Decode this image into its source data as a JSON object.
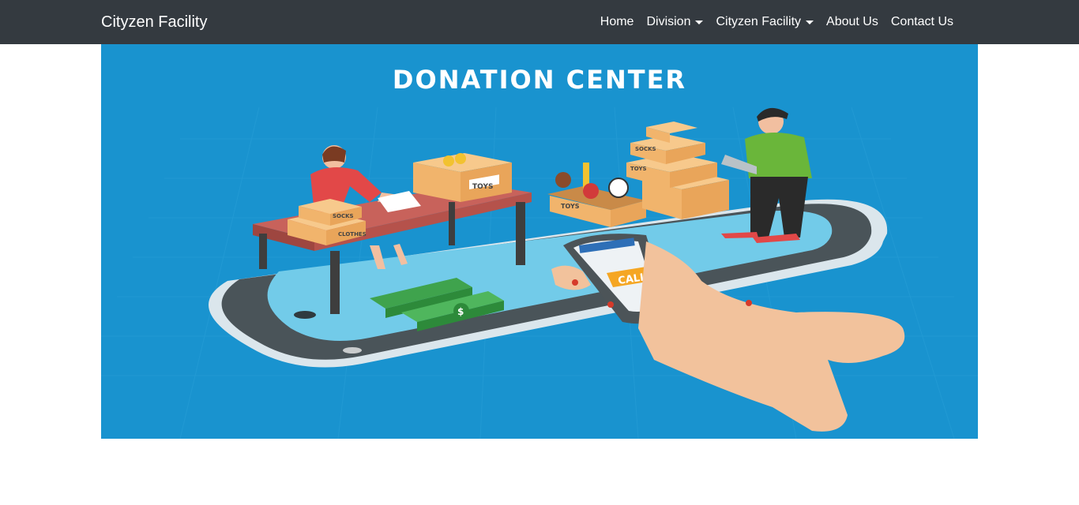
{
  "navbar": {
    "brand": "Cityzen Facility",
    "items": [
      {
        "label": "Home",
        "dropdown": false
      },
      {
        "label": "Division",
        "dropdown": true
      },
      {
        "label": "Cityzen Facility",
        "dropdown": true
      },
      {
        "label": "About Us",
        "dropdown": false
      },
      {
        "label": "Contact Us",
        "dropdown": false
      }
    ],
    "background": "#343a40"
  },
  "hero": {
    "title": "DONATION CENTER",
    "background": "#1993cf",
    "labels": {
      "toys_box_table": "TOYS",
      "socks": "SOCKS",
      "clothes": "CLOTHES",
      "toys_open_box": "TOYS",
      "socks_stack": "SOCKS",
      "toys_stack": "TOYS",
      "call_button": "CALL",
      "money_symbol": "$"
    }
  }
}
